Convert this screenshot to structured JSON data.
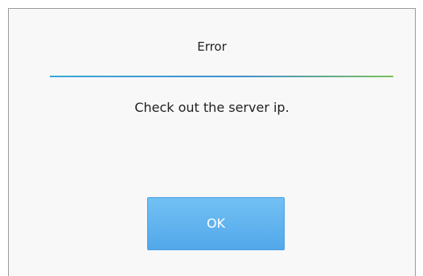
{
  "dialog": {
    "title": "Error",
    "message": "Check out the server ip.",
    "ok_label": "OK"
  },
  "colors": {
    "accent": "#52a8ea",
    "divider_start": "#37a8d8",
    "divider_end": "#7cc05a",
    "background": "#f8f8f8"
  }
}
